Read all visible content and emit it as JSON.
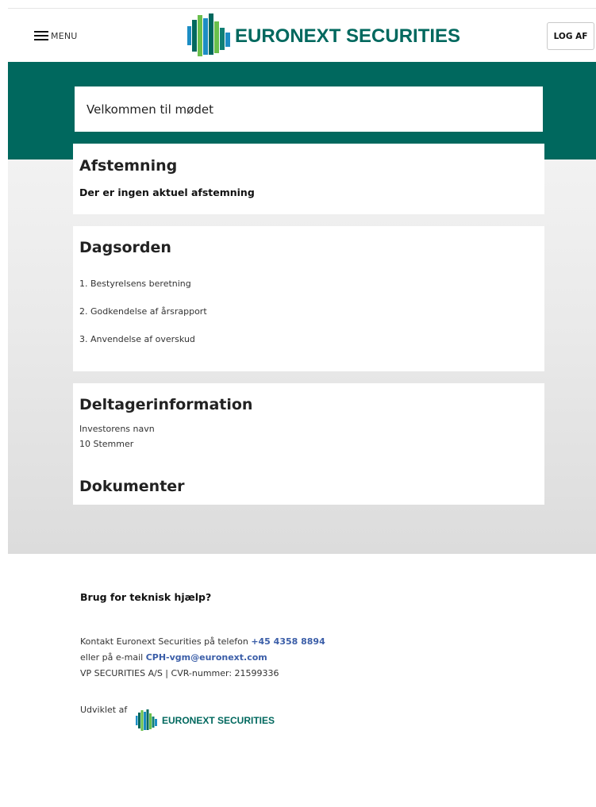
{
  "header": {
    "menu_label": "MENU",
    "brand_name": "EURONEXT SECURITIES",
    "logout_label": "LOG AF"
  },
  "welcome": {
    "text": "Velkommen til mødet"
  },
  "voting": {
    "title": "Afstemning",
    "status": "Der er ingen aktuel afstemning"
  },
  "agenda": {
    "title": "Dagsorden",
    "items": [
      "1. Bestyrelsens beretning",
      "2. Godkendelse af årsrapport",
      "3. Anvendelse af overskud"
    ]
  },
  "participant": {
    "title": "Deltagerinformation",
    "investor_name": "Investorens navn",
    "votes": "10 Stemmer",
    "documents_title": "Dokumenter"
  },
  "footer": {
    "help_title": "Brug for teknisk hjælp?",
    "contact_phone_prefix": "Kontakt Euronext Securities på telefon ",
    "phone": "+45 4358 8894",
    "contact_email_prefix": "eller på e-mail ",
    "email": "CPH-vgm@euronext.com",
    "company_line": "VP SECURITIES A/S | CVR-nummer: 21599336",
    "developed_by": "Udviklet af",
    "brand_name": "EURONEXT SECURITIES"
  },
  "colors": {
    "brand_teal": "#00685e",
    "brand_green": "#6abf4b",
    "brand_blue": "#1c8dc4",
    "link_blue": "#3b5ea8"
  },
  "icons": {
    "menu": "hamburger-menu-icon",
    "logo": "euronext-logo-icon"
  }
}
